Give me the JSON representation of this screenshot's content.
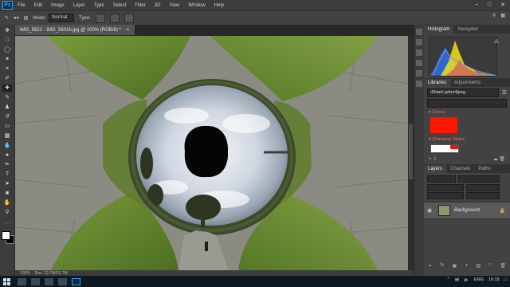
{
  "app": {
    "logo": "Ps"
  },
  "menubar": {
    "items": [
      "File",
      "Edit",
      "Image",
      "Layer",
      "Type",
      "Select",
      "Filter",
      "3D",
      "View",
      "Window",
      "Help"
    ]
  },
  "options": {
    "mode_label": "Mode:",
    "mode_value": "Normal",
    "type_label": "Type:"
  },
  "document": {
    "tab_title": "IMG_5621 - IMG_5601b.jpg @ 100% (RGB/8) *",
    "zoom": "100%",
    "doc_info": "Doc: 22.7M/22.7M"
  },
  "panels": {
    "histogram_tabs": [
      "Histogram",
      "Navigator"
    ],
    "libraries_tabs": [
      "Libraries",
      "Adjustments"
    ],
    "library_name": "d3dark.jp/ter4jpeg",
    "colors_label": "Colors",
    "character_styles_label": "Character Styles",
    "accent_color": "#ff1500",
    "layers_tabs": [
      "Layers",
      "Channels",
      "Paths"
    ],
    "layer_name": "Background"
  },
  "taskbar": {
    "lang": "ENG",
    "time": "16:18"
  }
}
